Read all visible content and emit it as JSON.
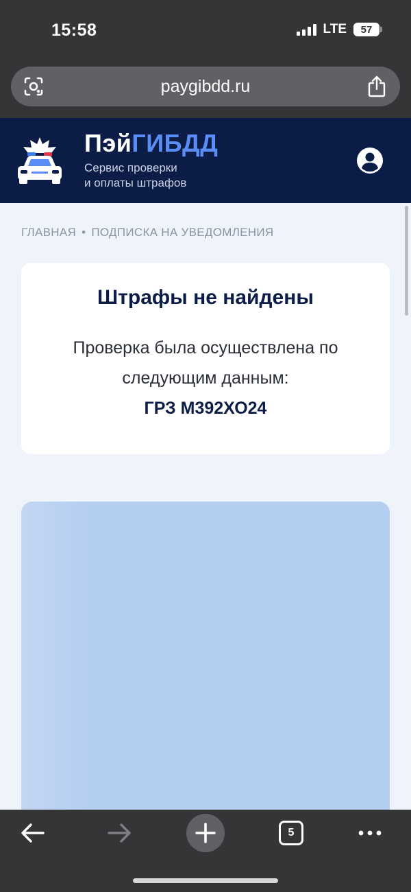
{
  "status_bar": {
    "time": "15:58",
    "network": "LTE",
    "battery": "57"
  },
  "browser": {
    "url": "paygibdd.ru",
    "tabs_count": "5",
    "icons": {
      "lens": "lens-icon",
      "share": "share-icon",
      "back": "back-arrow-icon",
      "forward": "forward-arrow-icon",
      "new_tab": "plus-icon",
      "more": "more-dots-icon"
    }
  },
  "header": {
    "brand_prefix": "Пэй",
    "brand_accent": "ГИБДД",
    "tagline_line1": "Сервис проверки",
    "tagline_line2": "и оплаты штрафов",
    "colors": {
      "background": "#0b1c46",
      "accent": "#5b8df7"
    }
  },
  "breadcrumb": {
    "item1": "ГЛАВНАЯ",
    "separator": "•",
    "item2": "ПОДПИСКА НА УВЕДОМЛЕНИЯ"
  },
  "result": {
    "title": "Штрафы не найдены",
    "line1": "Проверка была осуществлена по",
    "line2": "следующим данным:",
    "plate": "ГРЗ М392ХО24"
  }
}
